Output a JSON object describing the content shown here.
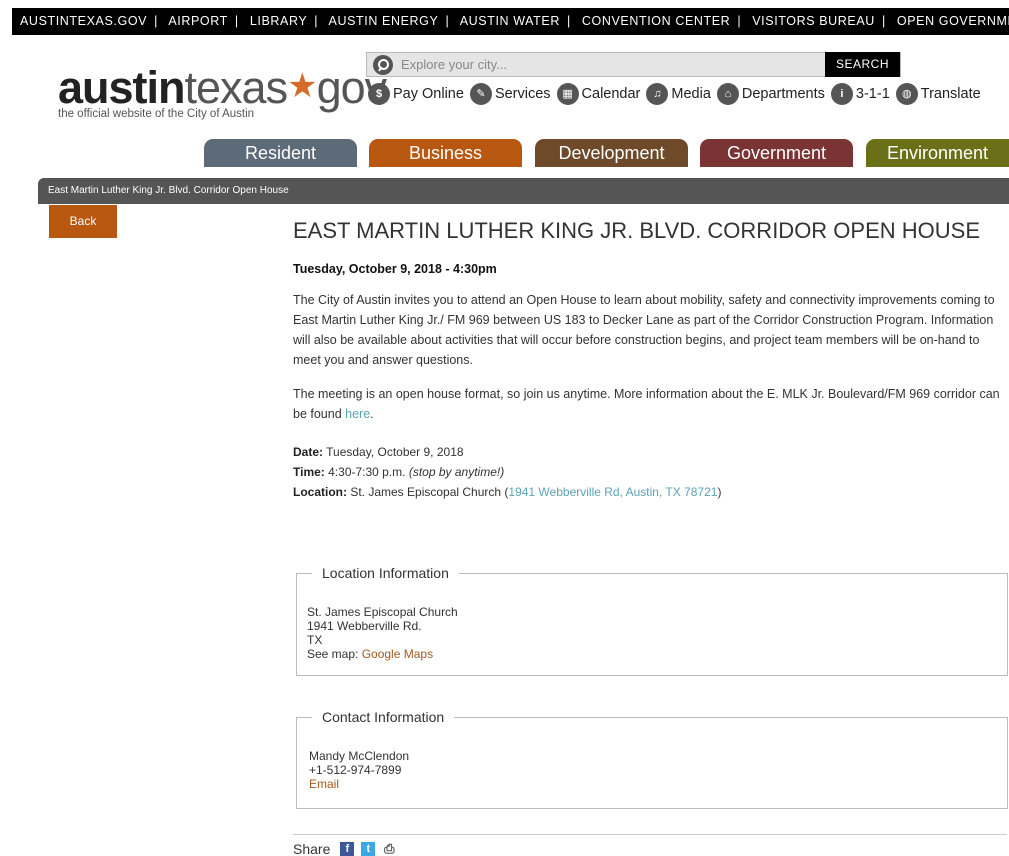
{
  "topbar": {
    "links": [
      "AUSTINTEXAS.GOV",
      "AIRPORT",
      "LIBRARY",
      "AUSTIN ENERGY",
      "AUSTIN WATER",
      "CONVENTION CENTER",
      "VISITORS BUREAU",
      "OPEN GOVERNMENT"
    ]
  },
  "logo": {
    "part1": "austin",
    "part2": "texas",
    "part3": "gov",
    "tagline": "the official website of the City of Austin"
  },
  "search": {
    "placeholder": "Explore your city...",
    "button": "SEARCH"
  },
  "quick_links": [
    {
      "label": "Pay Online",
      "icon": "pay-icon"
    },
    {
      "label": "Services",
      "icon": "services-icon"
    },
    {
      "label": "Calendar",
      "icon": "calendar-icon"
    },
    {
      "label": "Media",
      "icon": "media-icon"
    },
    {
      "label": "Departments",
      "icon": "departments-icon"
    },
    {
      "label": "3-1-1",
      "icon": "info-icon"
    },
    {
      "label": "Translate",
      "icon": "globe-icon"
    }
  ],
  "nav": {
    "tabs": [
      {
        "label": "Resident",
        "color": "#5d6a78"
      },
      {
        "label": "Business",
        "color": "#b8570f"
      },
      {
        "label": "Development",
        "color": "#6e4a2a"
      },
      {
        "label": "Government",
        "color": "#7a3434"
      },
      {
        "label": "Environment",
        "color": "#6b7018"
      }
    ]
  },
  "breadcrumb": "East Martin Luther King Jr. Blvd. Corridor Open House",
  "back_label": "Back",
  "article": {
    "title": "EAST MARTIN LUTHER KING JR. BLVD. CORRIDOR OPEN HOUSE",
    "when": "Tuesday, October 9, 2018 - 4:30pm",
    "p1": "The City of Austin invites you to attend an Open House to learn about mobility, safety and connectivity improvements coming to East Martin Luther King Jr./ FM 969 between US 183 to Decker Lane as part of the Corridor Construction Program. Information will also be available about activities that will occur before construction begins, and project team members will be on-hand to meet you and answer questions.",
    "p2_text": "The meeting is an open house format, so join us anytime. More information about the E. MLK Jr. Boulevard/FM 969 corridor can be found ",
    "p2_link": "here",
    "p2_end": ".",
    "date_label": "Date:",
    "date_value": " Tuesday, October 9, 2018",
    "time_label": "Time:",
    "time_value": " 4:30-7:30 p.m. ",
    "time_note": "(stop by anytime!)",
    "location_label": "Location:",
    "location_value": " St. James Episcopal Church (",
    "location_link": "1941 Webberville Rd, Austin, TX 78721",
    "location_end": ")"
  },
  "location_info": {
    "legend": "Location Information",
    "name": "St. James Episcopal Church",
    "street": "1941 Webberville Rd.",
    "state": "TX",
    "map_label": "See map: ",
    "map_link": "Google Maps"
  },
  "contact_info": {
    "legend": "Contact Information",
    "name": "Mandy McClendon",
    "phone": "+1-512-974-7899",
    "email": "Email"
  },
  "share": {
    "label": "Share"
  }
}
